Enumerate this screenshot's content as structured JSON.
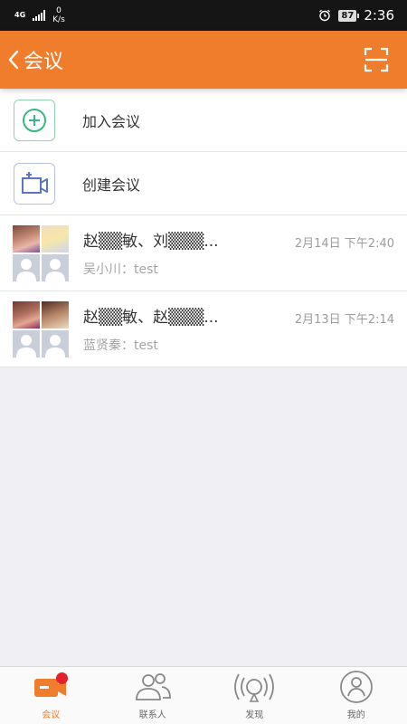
{
  "status_bar": {
    "network": "4G",
    "speed_value": "0",
    "speed_unit": "K/s",
    "battery": "87",
    "time": "2:36"
  },
  "header": {
    "title": "会议",
    "back_icon": "chevron-left-icon",
    "scan_icon": "scan-icon"
  },
  "actions": [
    {
      "label": "加入会议",
      "icon": "plus-circle-icon"
    },
    {
      "label": "创建会议",
      "icon": "video-add-icon"
    }
  ],
  "meetings": [
    {
      "title": "赵▒▒敏、刘▒▒▒...",
      "time": "2月14日 下午2:40",
      "last_message": "吴小川：test"
    },
    {
      "title": "赵▒▒敏、赵▒▒▒...",
      "time": "2月13日 下午2:14",
      "last_message": "蓝贤秦：test"
    }
  ],
  "bottom_nav": [
    {
      "label": "会议",
      "icon": "meeting-icon",
      "active": true,
      "badge": true
    },
    {
      "label": "联系人",
      "icon": "contacts-icon",
      "active": false
    },
    {
      "label": "发现",
      "icon": "discover-icon",
      "active": false
    },
    {
      "label": "我的",
      "icon": "profile-icon",
      "active": false
    }
  ],
  "colors": {
    "accent": "#f07d2b",
    "status_bar": "#151515",
    "background": "#efeff4",
    "badge": "#e5202b"
  }
}
